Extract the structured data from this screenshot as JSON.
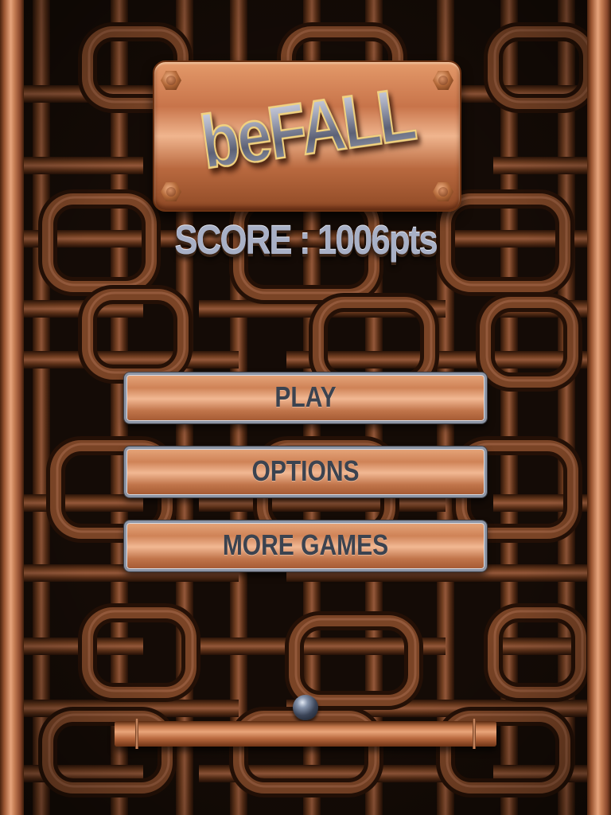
{
  "logo": {
    "text": "beFALL"
  },
  "score": {
    "text": "SCORE : 1006pts"
  },
  "menu": {
    "items": [
      {
        "label": "PLAY"
      },
      {
        "label": "OPTIONS"
      },
      {
        "label": "MORE GAMES"
      }
    ]
  },
  "colors": {
    "copper_light": "#f0b58e",
    "copper": "#c8744a",
    "copper_dark": "#6b3213",
    "pipe_background": "#140b06",
    "steel": "#a8b0c6",
    "button_text": "#3b4350",
    "logo_outline": "#f3d27d"
  },
  "icons": {
    "ball": "steel-ball",
    "paddle": "copper-pipe-paddle",
    "bolts": "hex-bolt"
  }
}
